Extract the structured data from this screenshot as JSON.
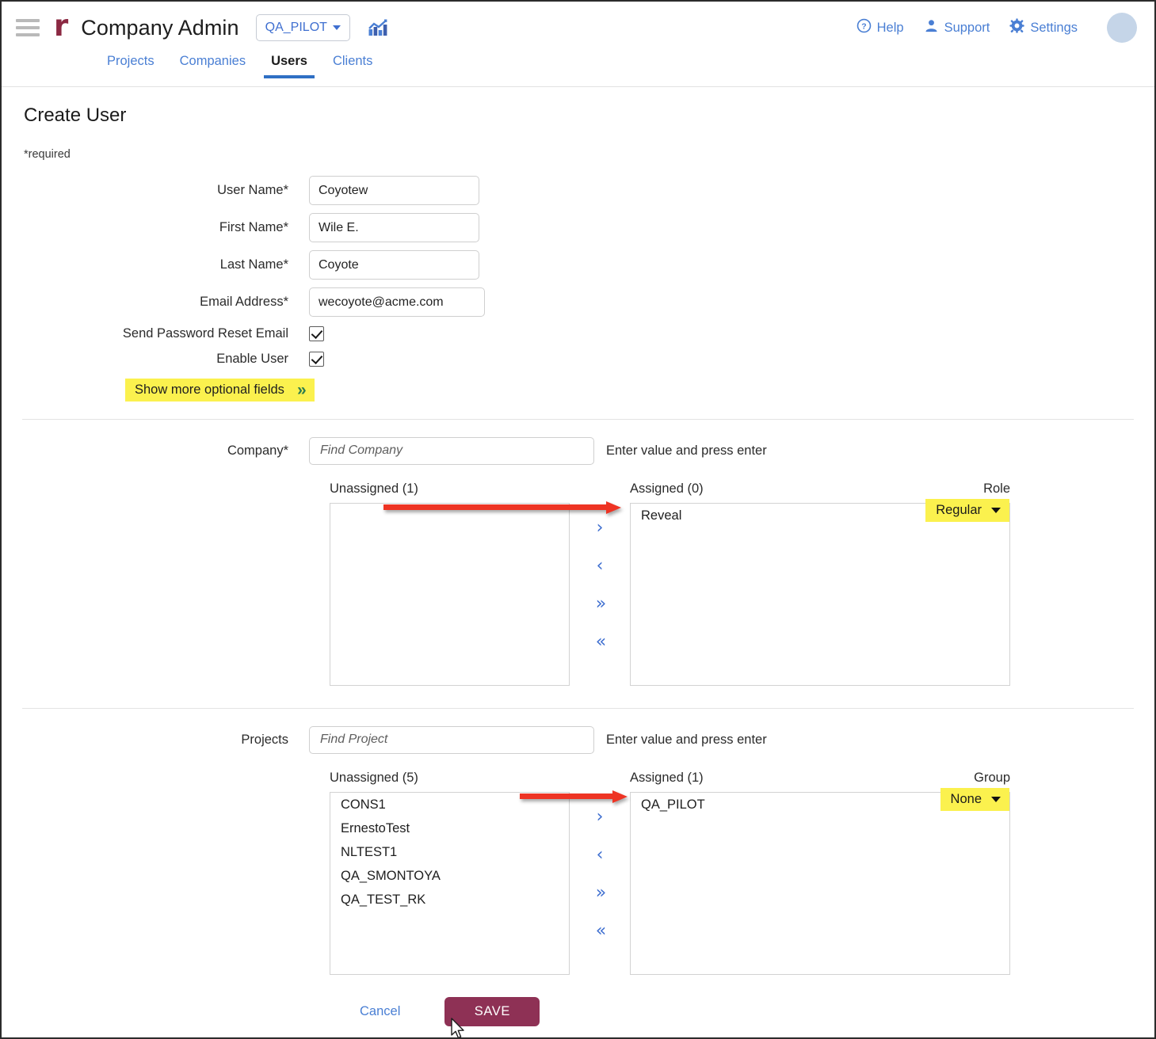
{
  "header": {
    "menu_icon": "hamburger-menu-icon",
    "logo": "r",
    "app_title": "Company Admin",
    "context_selector": "QA_PILOT",
    "analytics_icon": "bar-chart-icon",
    "links": [
      {
        "label": "Help",
        "icon": "help-circle-icon"
      },
      {
        "label": "Support",
        "icon": "support-person-icon"
      },
      {
        "label": "Settings",
        "icon": "gear-icon"
      }
    ],
    "avatar": "user-avatar"
  },
  "tabs": [
    {
      "label": "Projects",
      "active": false
    },
    {
      "label": "Companies",
      "active": false
    },
    {
      "label": "Users",
      "active": true
    },
    {
      "label": "Clients",
      "active": false
    }
  ],
  "page": {
    "title": "Create User",
    "required_note": "*required"
  },
  "form": {
    "fields": [
      {
        "label": "User Name*",
        "value": "Coyotew",
        "name": "user-name-field"
      },
      {
        "label": "First Name*",
        "value": "Wile E.",
        "name": "first-name-field"
      },
      {
        "label": "Last Name*",
        "value": "Coyote",
        "name": "last-name-field"
      },
      {
        "label": "Email Address*",
        "value": "wecoyote@acme.com",
        "name": "email-address-field"
      }
    ],
    "checkboxes": [
      {
        "label": "Send Password Reset Email",
        "checked": true
      },
      {
        "label": "Enable User",
        "checked": true
      }
    ],
    "show_more": {
      "label": "Show more optional fields",
      "chevron": "»",
      "highlight_color": "#fbf14e"
    }
  },
  "company_section": {
    "label": "Company*",
    "find_placeholder": "Find Company",
    "hint": "Enter value and press enter",
    "unassigned_header": "Unassigned (1)",
    "assigned_header": "Assigned (0)",
    "right_col_header": "Role",
    "unassigned_items": [],
    "assigned_items": [
      "Reveal"
    ],
    "role_value": "Regular",
    "role_highlight": "#fbf14e",
    "arrows": [
      "›",
      "‹",
      "»",
      "«"
    ]
  },
  "projects_section": {
    "label": "Projects",
    "find_placeholder": "Find Project",
    "hint": "Enter value and press enter",
    "unassigned_header": "Unassigned (5)",
    "assigned_header": "Assigned (1)",
    "right_col_header": "Group",
    "unassigned_items": [
      "CONS1",
      "ErnestoTest",
      "NLTEST1",
      "QA_SMONTOYA",
      "QA_TEST_RK"
    ],
    "assigned_items": [
      "QA_PILOT"
    ],
    "group_value": "None",
    "group_highlight": "#fbf14e",
    "arrows": [
      "›",
      "‹",
      "»",
      "«"
    ]
  },
  "actions": {
    "cancel_label": "Cancel",
    "save_label": "SAVE",
    "save_color": "#8e3155"
  },
  "annotations": {
    "arrow_color": "#ee3424",
    "arrow_company": "points from Unassigned list to assigned Reveal row",
    "arrow_projects": "points from Unassigned list to assigned QA_PILOT row"
  }
}
